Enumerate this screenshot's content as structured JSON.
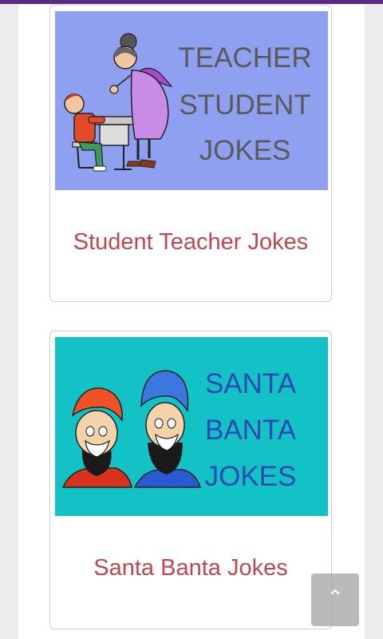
{
  "colors": {
    "top_bar": "#5c2a86",
    "card_title": "#c0474f",
    "teacher_bg": "#8fa0f0",
    "santa_bg": "#12c2c4"
  },
  "cards": [
    {
      "image_text": [
        "TEACHER",
        "STUDENT",
        "JOKES"
      ],
      "title": "Student Teacher Jokes"
    },
    {
      "image_text": [
        "SANTA",
        "BANTA",
        "JOKES"
      ],
      "title": "Santa Banta Jokes"
    }
  ],
  "scroll_top": {
    "icon": "chevron-up-icon",
    "glyph": "⌃"
  }
}
